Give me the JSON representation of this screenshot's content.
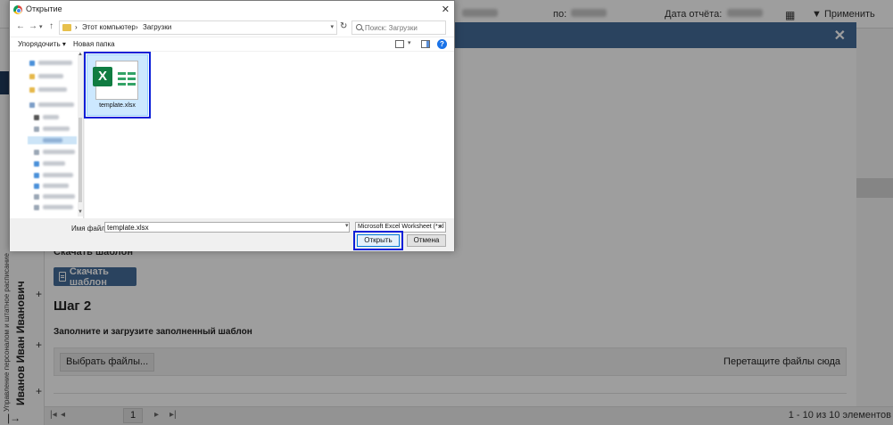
{
  "app": {
    "topbar": {
      "to_label": "по:",
      "report_date_label": "Дата отчёта:",
      "apply_label": "Применить"
    },
    "sidebar": {
      "user_name": "Иванов Иван Иванович",
      "subtitle": "Управление персоналом и штатное расписание"
    },
    "pager": {
      "current_page": "1",
      "total_text": "1 - 10 из 10 элементов"
    }
  },
  "modal": {
    "step1_partial": "Скачать шаблон",
    "download_button": "Скачать шаблон",
    "step2_title": "Шаг 2",
    "step2_text": "Заполните и загрузите заполненный шаблон",
    "choose_files_button": "Выбрать файлы...",
    "drop_hint": "Перетащите файлы сюда",
    "close_glyph": "✕"
  },
  "dialog": {
    "title": "Открытие",
    "close_glyph": "✕",
    "breadcrumb": [
      "Этот компьютер",
      "Загрузки"
    ],
    "search_placeholder": "Поиск: Загрузки",
    "organize_label": "Упорядочить ▾",
    "new_folder_label": "Новая папка",
    "help_glyph": "?",
    "file": {
      "name": "template.xlsx",
      "icon": "excel-file-icon",
      "badge": "X"
    },
    "file_name_label": "Имя файла:",
    "file_name_value": "template.xlsx",
    "file_type_value": "Microsoft Excel Worksheet (*.xl",
    "open_button": "Открыть",
    "cancel_button": "Отмена"
  },
  "colors": {
    "modal_header": "#456c9a",
    "excel_green": "#107c41",
    "highlight_outline": "#0b1fd8",
    "selection": "#cce8ff"
  }
}
